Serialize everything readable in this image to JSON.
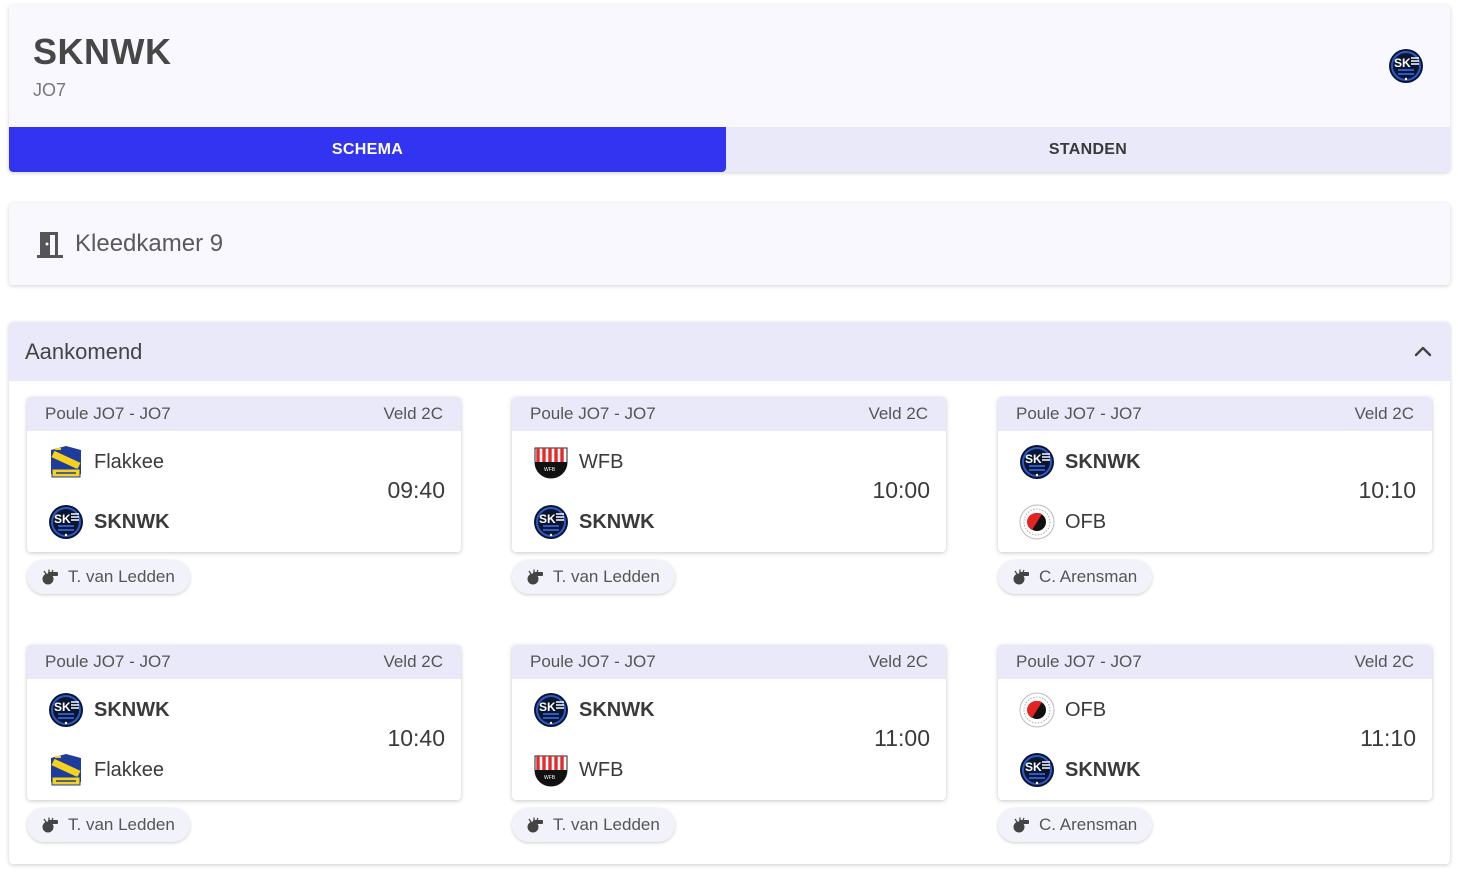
{
  "header": {
    "title": "SKNWK",
    "subtitle": "JO7"
  },
  "tabs": [
    {
      "label": "SCHEMA",
      "active": true
    },
    {
      "label": "STANDEN",
      "active": false
    }
  ],
  "room": {
    "label": "Kleedkamer 9",
    "icon": "door-icon"
  },
  "upcoming": {
    "title": "Aankomend",
    "matches": [
      {
        "poule": "Poule JO7 - JO7",
        "field": "Veld 2C",
        "home": "Flakkee",
        "away": "SKNWK",
        "time": "09:40",
        "referee": "T. van Ledden"
      },
      {
        "poule": "Poule JO7 - JO7",
        "field": "Veld 2C",
        "home": "WFB",
        "away": "SKNWK",
        "time": "10:00",
        "referee": "T. van Ledden"
      },
      {
        "poule": "Poule JO7 - JO7",
        "field": "Veld 2C",
        "home": "SKNWK",
        "away": "OFB",
        "time": "10:10",
        "referee": "C. Arensman"
      },
      {
        "poule": "Poule JO7 - JO7",
        "field": "Veld 2C",
        "home": "SKNWK",
        "away": "Flakkee",
        "time": "10:40",
        "referee": "T. van Ledden"
      },
      {
        "poule": "Poule JO7 - JO7",
        "field": "Veld 2C",
        "home": "SKNWK",
        "away": "WFB",
        "time": "11:00",
        "referee": "T. van Ledden"
      },
      {
        "poule": "Poule JO7 - JO7",
        "field": "Veld 2C",
        "home": "OFB",
        "away": "SKNWK",
        "time": "11:10",
        "referee": "C. Arensman"
      }
    ]
  },
  "colors": {
    "accent": "#3333f2",
    "tab_inactive": "#e9e9fa",
    "card_bg": "#f9f8fe"
  }
}
